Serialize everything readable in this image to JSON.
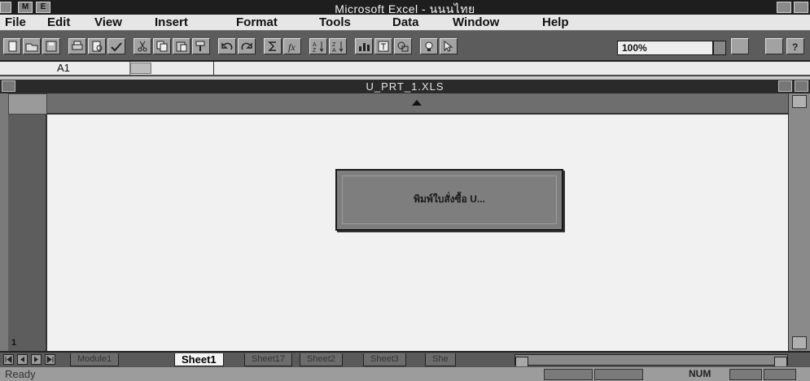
{
  "app": {
    "title": "Microsoft Excel - นนนไทย",
    "control_label": "M"
  },
  "menu": {
    "items": [
      "File",
      "Edit",
      "View",
      "Insert",
      "Format",
      "Tools",
      "Data",
      "Window",
      "Help"
    ]
  },
  "toolbar": {
    "zoom_value": "100%"
  },
  "formula_bar": {
    "name_box": "A1"
  },
  "document": {
    "title": "U_PRT_1.XLS"
  },
  "grid": {
    "row_number": "1"
  },
  "dialog": {
    "message": "พิมพ์ใบสั่งซื้อ U..."
  },
  "tabs": {
    "items": [
      {
        "label": "Module1",
        "active": false
      },
      {
        "label": "Sheet1",
        "active": true
      },
      {
        "label": "Sheet17",
        "active": false
      },
      {
        "label": "Sheet2",
        "active": false
      },
      {
        "label": "Sheet3",
        "active": false
      },
      {
        "label": "She",
        "active": false
      }
    ]
  },
  "status": {
    "text": "Ready",
    "num": "NUM"
  }
}
